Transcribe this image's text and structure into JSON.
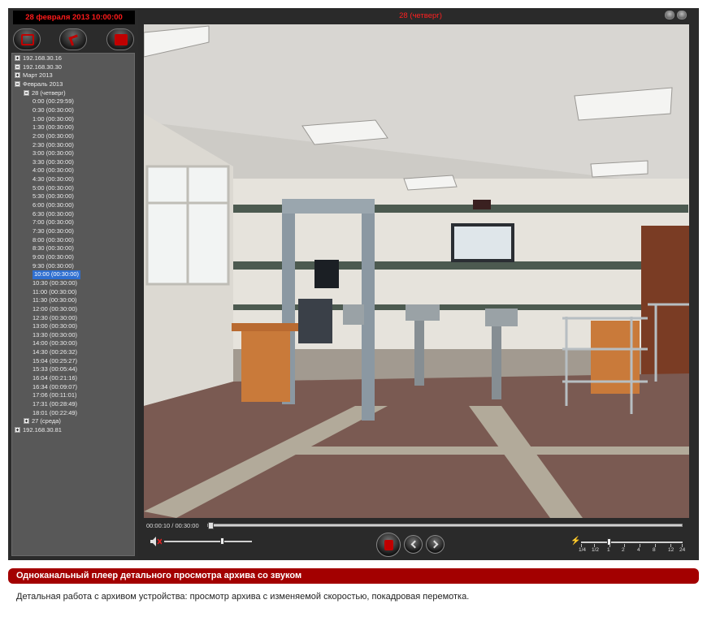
{
  "left_panel": {
    "date_display": "28 февраля 2013 10:00:00",
    "toolbar_icons": [
      "stop-icon",
      "export-icon",
      "save-icon"
    ],
    "tree": [
      {
        "label": "192.168.30.16",
        "level": 0,
        "expander": "plus"
      },
      {
        "label": "192.168.30.30",
        "level": 0,
        "expander": "minus"
      },
      {
        "label": "Март 2013",
        "level": 1,
        "expander": "plus"
      },
      {
        "label": "Февраль 2013",
        "level": 1,
        "expander": "minus"
      },
      {
        "label": "28 (четверг)",
        "level": 2,
        "expander": "minus"
      },
      {
        "label": "0:00 (00:29:59)",
        "level": 3
      },
      {
        "label": "0:30 (00:30:00)",
        "level": 3
      },
      {
        "label": "1:00 (00:30:00)",
        "level": 3
      },
      {
        "label": "1:30 (00:30:00)",
        "level": 3
      },
      {
        "label": "2:00 (00:30:00)",
        "level": 3
      },
      {
        "label": "2:30 (00:30:00)",
        "level": 3
      },
      {
        "label": "3:00 (00:30:00)",
        "level": 3
      },
      {
        "label": "3:30 (00:30:00)",
        "level": 3
      },
      {
        "label": "4:00 (00:30:00)",
        "level": 3
      },
      {
        "label": "4:30 (00:30:00)",
        "level": 3
      },
      {
        "label": "5:00 (00:30:00)",
        "level": 3
      },
      {
        "label": "5:30 (00:30:00)",
        "level": 3
      },
      {
        "label": "6:00 (00:30:00)",
        "level": 3
      },
      {
        "label": "6:30 (00:30:00)",
        "level": 3
      },
      {
        "label": "7:00 (00:30:00)",
        "level": 3
      },
      {
        "label": "7:30 (00:30:00)",
        "level": 3
      },
      {
        "label": "8:00 (00:30:00)",
        "level": 3
      },
      {
        "label": "8:30 (00:30:00)",
        "level": 3
      },
      {
        "label": "9:00 (00:30:00)",
        "level": 3
      },
      {
        "label": "9:30 (00:30:00)",
        "level": 3
      },
      {
        "label": "10:00 (00:30:00)",
        "level": 3,
        "selected": true
      },
      {
        "label": "10:30 (00:30:00)",
        "level": 3
      },
      {
        "label": "11:00 (00:30:00)",
        "level": 3
      },
      {
        "label": "11:30 (00:30:00)",
        "level": 3
      },
      {
        "label": "12:00 (00:30:00)",
        "level": 3
      },
      {
        "label": "12:30 (00:30:00)",
        "level": 3
      },
      {
        "label": "13:00 (00:30:00)",
        "level": 3
      },
      {
        "label": "13:30 (00:30:00)",
        "level": 3
      },
      {
        "label": "14:00 (00:30:00)",
        "level": 3
      },
      {
        "label": "14:30 (00:26:32)",
        "level": 3
      },
      {
        "label": "15:04 (00:25:27)",
        "level": 3
      },
      {
        "label": "15:33 (00:05:44)",
        "level": 3
      },
      {
        "label": "16:04 (00:21:16)",
        "level": 3
      },
      {
        "label": "16:34 (00:09:07)",
        "level": 3
      },
      {
        "label": "17:06 (00:11:01)",
        "level": 3
      },
      {
        "label": "17:31 (00:28:49)",
        "level": 3
      },
      {
        "label": "18:01 (00:22:49)",
        "level": 3
      },
      {
        "label": "27 (среда)",
        "level": 2,
        "expander": "plus"
      },
      {
        "label": "192.168.30.81",
        "level": 0,
        "expander": "plus"
      }
    ]
  },
  "video_panel": {
    "title": "28 (четверг)",
    "timecode": "00:00:10  /  00:30:00",
    "progress_fraction": 0.0056,
    "volume_fraction": 0.67,
    "speed_labels": [
      "1/4",
      "1/2",
      "1",
      "2",
      "4",
      "8",
      "12",
      "24"
    ],
    "speed_selected": "1",
    "icons": {
      "mute": "speaker-muted-icon",
      "play": "pause-icon",
      "prev": "frame-back-icon",
      "next": "frame-forward-icon",
      "speed": "speed-icon"
    }
  },
  "caption": {
    "title": "Одноканальный плеер детального просмотра архива со звуком",
    "description": "Детальная работа с архивом устройства: просмотр архива с изменяемой скоростью, покадровая перемотка."
  },
  "colors": {
    "accent_red": "#a30000",
    "digit_red": "#ff1a1a",
    "selection": "#2f6fd0"
  }
}
